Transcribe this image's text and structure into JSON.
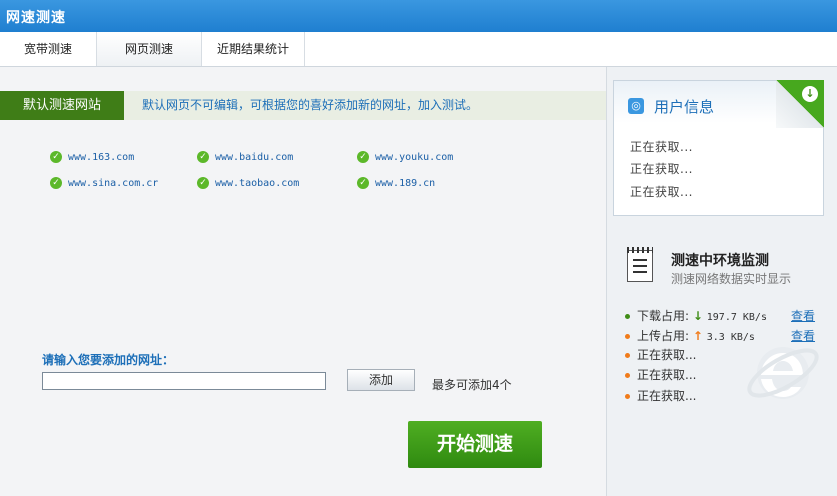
{
  "window": {
    "title": "网速测速"
  },
  "tabs": [
    {
      "label": "宽带测速"
    },
    {
      "label": "网页测速"
    },
    {
      "label": "近期结果统计"
    }
  ],
  "default_sites": {
    "label": "默认测速网站",
    "hint": "默认网页不可编辑，可根据您的喜好添加新的网址，加入测试。",
    "sites": [
      "www.163.com",
      "www.baidu.com",
      "www.youku.com",
      "www.sina.com.cr",
      "www.taobao.com",
      "www.189.cn"
    ]
  },
  "add_url": {
    "label": "请输入您要添加的网址：",
    "input_value": "",
    "button": "添加",
    "limit_hint": "最多可添加4个"
  },
  "start_button": "开始测速",
  "user_info": {
    "title": "用户信息",
    "lines": [
      "正在获取...",
      "正在获取...",
      "正在获取..."
    ]
  },
  "monitor": {
    "title": "测速中环境监测",
    "subtitle": "测速网络数据实时显示",
    "download": {
      "label": "下载占用:",
      "value": "197.7 KB/s",
      "link": "查看"
    },
    "upload": {
      "label": "上传占用:",
      "value": "3.3 KB/s",
      "link": "查看"
    },
    "pending": [
      "正在获取...",
      "正在获取...",
      "正在获取..."
    ]
  },
  "colors": {
    "titlebar": "#2a8ad8",
    "accent_green": "#3f7d17",
    "link_blue": "#1d6fb8",
    "download_dot": "#3f8d17",
    "upload_dot": "#f07b1a"
  }
}
